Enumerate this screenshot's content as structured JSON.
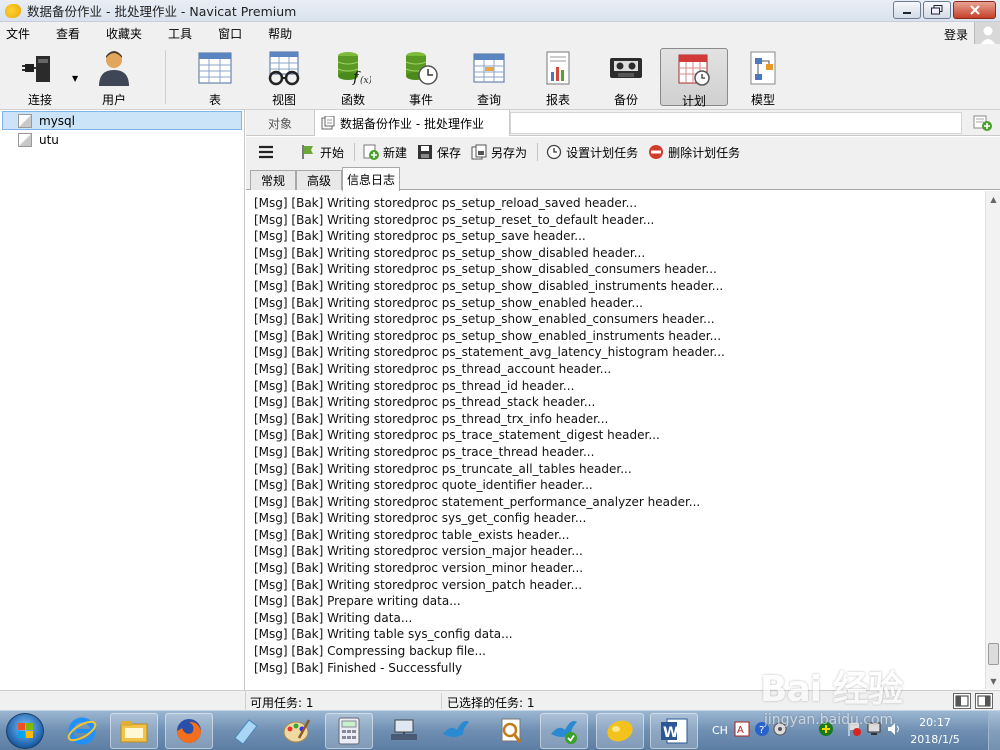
{
  "window": {
    "title": "数据备份作业 - 批处理作业 - Navicat Premium",
    "min": "0",
    "max": "1",
    "close": "r"
  },
  "menu": {
    "items": [
      "文件",
      "查看",
      "收藏夹",
      "工具",
      "窗口",
      "帮助"
    ],
    "login": "登录"
  },
  "toolbar": {
    "buttons": [
      {
        "label": "连接",
        "icon": "plug-icon"
      },
      {
        "label": "用户",
        "icon": "user-icon"
      },
      {
        "label": "表",
        "icon": "table-icon"
      },
      {
        "label": "视图",
        "icon": "view-glasses-icon"
      },
      {
        "label": "函数",
        "icon": "function-icon"
      },
      {
        "label": "事件",
        "icon": "event-icon"
      },
      {
        "label": "查询",
        "icon": "query-icon"
      },
      {
        "label": "报表",
        "icon": "report-icon"
      },
      {
        "label": "备份",
        "icon": "backup-icon"
      },
      {
        "label": "计划",
        "icon": "calendar-icon",
        "active": true
      },
      {
        "label": "模型",
        "icon": "model-icon"
      }
    ]
  },
  "connections": [
    {
      "name": "mysql",
      "selected": true
    },
    {
      "name": "utu",
      "selected": false
    }
  ],
  "tabs": {
    "objects": "对象",
    "document": "数据备份作业 - 批处理作业"
  },
  "actions": {
    "start": "开始",
    "new": "新建",
    "save": "保存",
    "save_as": "另存为",
    "set_schedule": "设置计划任务",
    "delete_schedule": "删除计划任务"
  },
  "subtabs": [
    "常规",
    "高级",
    "信息日志"
  ],
  "log_lines": [
    "[Msg] [Bak] Writing storedproc ps_setup_reload_saved header...",
    "[Msg] [Bak] Writing storedproc ps_setup_reset_to_default header...",
    "[Msg] [Bak] Writing storedproc ps_setup_save header...",
    "[Msg] [Bak] Writing storedproc ps_setup_show_disabled header...",
    "[Msg] [Bak] Writing storedproc ps_setup_show_disabled_consumers header...",
    "[Msg] [Bak] Writing storedproc ps_setup_show_disabled_instruments header...",
    "[Msg] [Bak] Writing storedproc ps_setup_show_enabled header...",
    "[Msg] [Bak] Writing storedproc ps_setup_show_enabled_consumers header...",
    "[Msg] [Bak] Writing storedproc ps_setup_show_enabled_instruments header...",
    "[Msg] [Bak] Writing storedproc ps_statement_avg_latency_histogram header...",
    "[Msg] [Bak] Writing storedproc ps_thread_account header...",
    "[Msg] [Bak] Writing storedproc ps_thread_id header...",
    "[Msg] [Bak] Writing storedproc ps_thread_stack header...",
    "[Msg] [Bak] Writing storedproc ps_thread_trx_info header...",
    "[Msg] [Bak] Writing storedproc ps_trace_statement_digest header...",
    "[Msg] [Bak] Writing storedproc ps_trace_thread header...",
    "[Msg] [Bak] Writing storedproc ps_truncate_all_tables header...",
    "[Msg] [Bak] Writing storedproc quote_identifier header...",
    "[Msg] [Bak] Writing storedproc statement_performance_analyzer header...",
    "[Msg] [Bak] Writing storedproc sys_get_config header...",
    "[Msg] [Bak] Writing storedproc table_exists header...",
    "[Msg] [Bak] Writing storedproc version_major header...",
    "[Msg] [Bak] Writing storedproc version_minor header...",
    "[Msg] [Bak] Writing storedproc version_patch header...",
    "[Msg] [Bak] Prepare writing data...",
    "[Msg] [Bak] Writing data...",
    "[Msg] [Bak] Writing table sys_config data...",
    "[Msg] [Bak] Compressing backup file...",
    "[Msg] [Bak] Finished - Successfully"
  ],
  "status": {
    "available_tasks": "可用任务: 1",
    "selected_tasks": "已选择的任务: 1"
  },
  "taskbar": {
    "apps": [
      "windows-start-icon",
      "internet-explorer-icon",
      "file-explorer-icon",
      "firefox-icon",
      "notepad-icon",
      "paint-icon",
      "calculator-icon",
      "network-icon",
      "bird-icon",
      "search-tool-icon",
      "bird-check-icon",
      "navicat-icon",
      "word-icon"
    ],
    "lang": "CH",
    "time": "20:17",
    "date": "2018/1/5"
  },
  "watermark": {
    "text": "Bai 经验",
    "url": "jingyan.baidu.com"
  }
}
